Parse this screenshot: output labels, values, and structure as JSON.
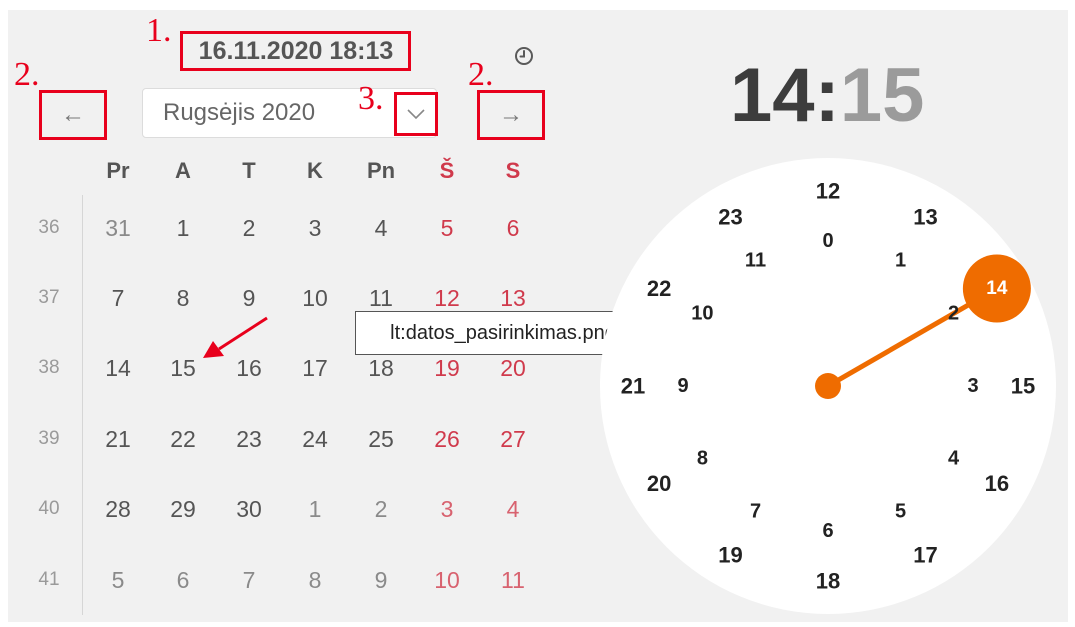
{
  "header": {
    "datetime": "16.11.2020 18:13",
    "clock_icon": "clock-icon"
  },
  "annotations": [
    "1.",
    "2.",
    "3.",
    "2."
  ],
  "navigation": {
    "prev_label": "←",
    "next_label": "→",
    "month_label": "Rugsėjis 2020",
    "dropdown_icon": "chevron-down-icon"
  },
  "weekdays": [
    "Pr",
    "A",
    "T",
    "K",
    "Pn",
    "Š",
    "S"
  ],
  "weeks": [
    {
      "number": "36",
      "days": [
        "31",
        "1",
        "2",
        "3",
        "4",
        "5",
        "6"
      ]
    },
    {
      "number": "37",
      "days": [
        "7",
        "8",
        "9",
        "10",
        "11",
        "12",
        "13"
      ]
    },
    {
      "number": "38",
      "days": [
        "14",
        "15",
        "16",
        "17",
        "18",
        "19",
        "20"
      ]
    },
    {
      "number": "39",
      "days": [
        "21",
        "22",
        "23",
        "24",
        "25",
        "26",
        "27"
      ]
    },
    {
      "number": "40",
      "days": [
        "28",
        "29",
        "30",
        "1",
        "2",
        "3",
        "4"
      ]
    },
    {
      "number": "41",
      "days": [
        "5",
        "6",
        "7",
        "8",
        "9",
        "10",
        "11"
      ]
    }
  ],
  "tooltip": "lt:datos_pasirinkimas.png",
  "time": {
    "hours": "14",
    "separator": ":",
    "minutes": "15"
  },
  "clock": {
    "outer_hours": [
      "12",
      "13",
      "14",
      "15",
      "16",
      "17",
      "18",
      "19",
      "20",
      "21",
      "22",
      "23"
    ],
    "inner_hours": [
      "0",
      "1",
      "2",
      "3",
      "4",
      "5",
      "6",
      "7",
      "8",
      "9",
      "10",
      "11"
    ],
    "selected_hour": "14",
    "accent_color": "#ef6c00"
  },
  "colors": {
    "weekend": "#d03a4c",
    "annotation": "#e8001c"
  }
}
